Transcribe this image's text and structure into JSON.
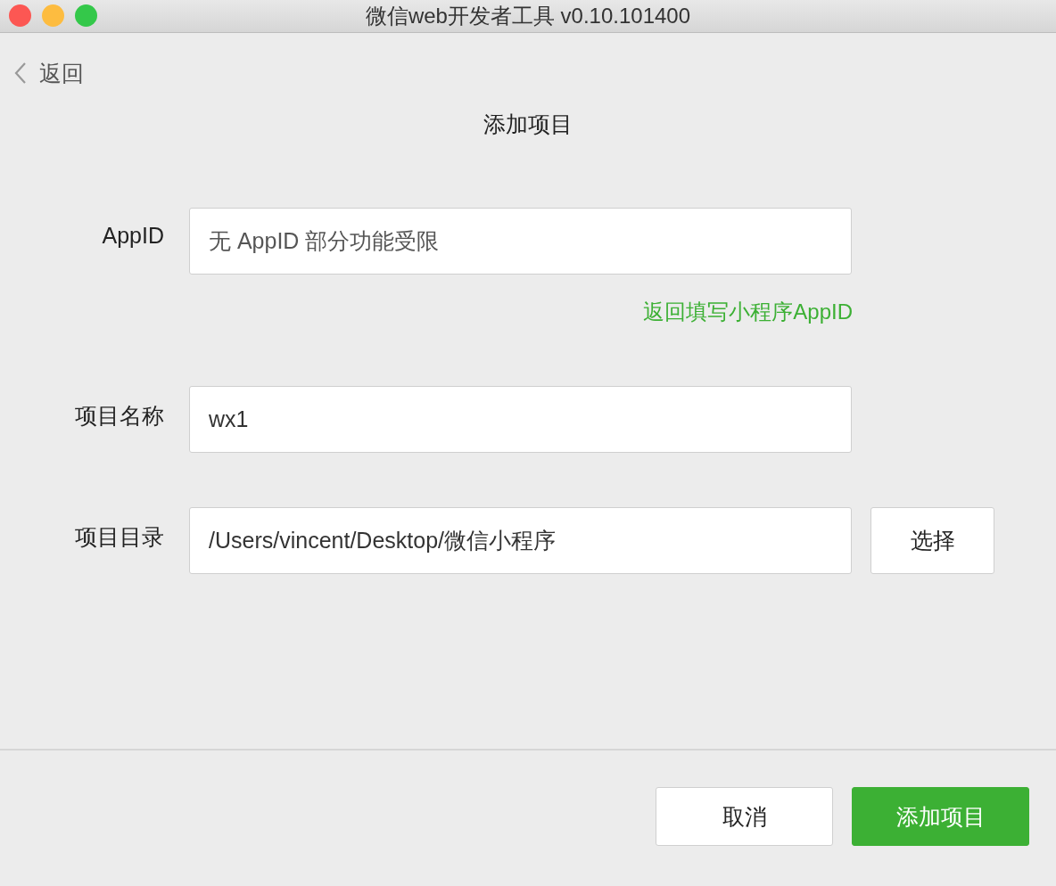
{
  "window": {
    "title": "微信web开发者工具 v0.10.101400"
  },
  "back": {
    "label": "返回"
  },
  "page_title": "添加项目",
  "form": {
    "rows": [
      {
        "label": "AppID",
        "value": "无 AppID 部分功能受限"
      },
      {
        "label": "项目名称",
        "value": "wx1"
      },
      {
        "label": "项目目录",
        "value": "/Users/vincent/Desktop/微信小程序",
        "button": "选择"
      }
    ],
    "appid_link": "返回填写小程序AppID"
  },
  "buttons": [
    {
      "label": "取消",
      "kind": "secondary"
    },
    {
      "label": "添加项目",
      "kind": "primary"
    }
  ]
}
